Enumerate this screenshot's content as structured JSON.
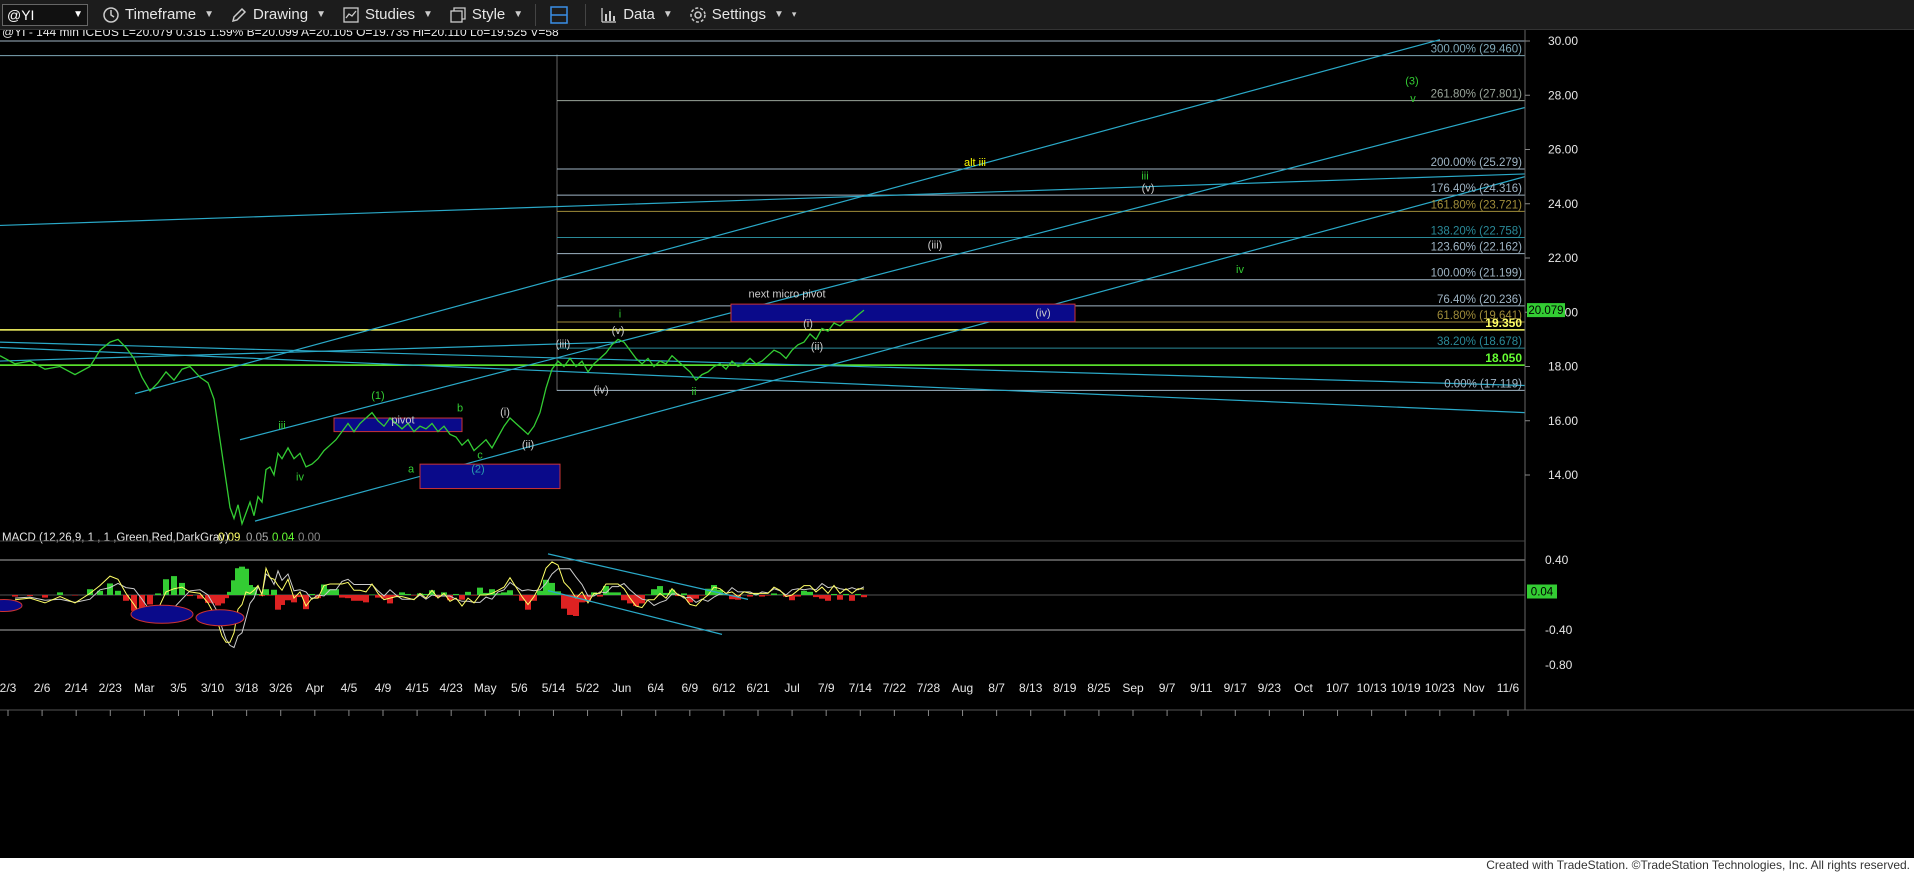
{
  "toolbar": {
    "symbol": "@YI",
    "items": [
      {
        "name": "timeframe",
        "label": "Timeframe",
        "icon": "clock-icon"
      },
      {
        "name": "drawing",
        "label": "Drawing",
        "icon": "pen-icon"
      },
      {
        "name": "studies",
        "label": "Studies",
        "icon": "studies-icon"
      },
      {
        "name": "style",
        "label": "Style",
        "icon": "style-icon"
      },
      {
        "name": "data",
        "label": "Data",
        "icon": "data-icon"
      },
      {
        "name": "settings",
        "label": "Settings",
        "icon": "gear-icon"
      }
    ]
  },
  "quote_header": {
    "line": "@YI - 144 min  ICEUS  L=20.079  0.315  1.59%  B=20.099  A=20.105  O=19.735  Hi=20.110  Lo=19.525  V=58"
  },
  "chart_data": {
    "type": "line",
    "symbol": "@YI",
    "interval": "144 min",
    "ylim": [
      12,
      30.2
    ],
    "price_ticks": [
      14,
      16,
      18,
      20,
      22,
      24,
      26,
      28,
      30
    ],
    "last_price": "20.079",
    "x_labels": [
      "2/3",
      "2/6",
      "2/14",
      "2/23",
      "Mar",
      "3/5",
      "3/10",
      "3/18",
      "3/26",
      "Apr",
      "4/5",
      "4/9",
      "4/15",
      "4/23",
      "May",
      "5/6",
      "5/14",
      "5/22",
      "Jun",
      "6/4",
      "6/9",
      "6/12",
      "6/21",
      "Jul",
      "7/9",
      "7/14",
      "7/22",
      "7/28",
      "Aug",
      "8/7",
      "8/13",
      "8/19",
      "8/25",
      "Sep",
      "9/7",
      "9/11",
      "9/17",
      "9/23",
      "Oct",
      "10/7",
      "10/13",
      "10/19",
      "10/23",
      "Nov",
      "11/6"
    ],
    "price_path": [
      [
        0,
        18.4
      ],
      [
        15,
        18.1
      ],
      [
        30,
        18.2
      ],
      [
        45,
        17.9
      ],
      [
        60,
        18.0
      ],
      [
        75,
        17.7
      ],
      [
        90,
        18.0
      ],
      [
        100,
        18.6
      ],
      [
        110,
        18.9
      ],
      [
        118,
        19.0
      ],
      [
        126,
        18.7
      ],
      [
        134,
        18.3
      ],
      [
        142,
        17.6
      ],
      [
        150,
        17.1
      ],
      [
        158,
        17.4
      ],
      [
        166,
        17.8
      ],
      [
        174,
        17.5
      ],
      [
        182,
        17.9
      ],
      [
        190,
        18.0
      ],
      [
        200,
        17.6
      ],
      [
        208,
        17.4
      ],
      [
        214,
        16.8
      ],
      [
        218,
        15.8
      ],
      [
        222,
        14.8
      ],
      [
        226,
        13.8
      ],
      [
        230,
        12.8
      ],
      [
        234,
        12.4
      ],
      [
        238,
        12.9
      ],
      [
        242,
        12.2
      ],
      [
        246,
        12.6
      ],
      [
        250,
        13.0
      ],
      [
        254,
        12.5
      ],
      [
        258,
        13.2
      ],
      [
        262,
        13.0
      ],
      [
        266,
        14.2
      ],
      [
        270,
        14.3
      ],
      [
        274,
        14.0
      ],
      [
        278,
        14.8
      ],
      [
        282,
        14.6
      ],
      [
        288,
        15.0
      ],
      [
        294,
        14.6
      ],
      [
        300,
        14.8
      ],
      [
        306,
        14.3
      ],
      [
        312,
        14.4
      ],
      [
        318,
        14.6
      ],
      [
        324,
        14.9
      ],
      [
        330,
        15.1
      ],
      [
        336,
        15.3
      ],
      [
        342,
        15.6
      ],
      [
        348,
        15.9
      ],
      [
        354,
        15.6
      ],
      [
        360,
        15.9
      ],
      [
        366,
        16.1
      ],
      [
        372,
        16.3
      ],
      [
        378,
        16.0
      ],
      [
        384,
        15.8
      ],
      [
        390,
        16.1
      ],
      [
        396,
        15.9
      ],
      [
        402,
        15.7
      ],
      [
        408,
        15.9
      ],
      [
        414,
        15.6
      ],
      [
        420,
        15.8
      ],
      [
        426,
        15.7
      ],
      [
        432,
        15.9
      ],
      [
        438,
        15.6
      ],
      [
        444,
        15.8
      ],
      [
        450,
        15.5
      ],
      [
        456,
        15.4
      ],
      [
        462,
        15.1
      ],
      [
        468,
        15.3
      ],
      [
        474,
        14.9
      ],
      [
        480,
        15.1
      ],
      [
        486,
        15.3
      ],
      [
        492,
        15.0
      ],
      [
        498,
        15.4
      ],
      [
        504,
        15.8
      ],
      [
        510,
        16.1
      ],
      [
        516,
        15.9
      ],
      [
        522,
        15.7
      ],
      [
        528,
        15.5
      ],
      [
        534,
        15.8
      ],
      [
        540,
        16.3
      ],
      [
        546,
        17.2
      ],
      [
        552,
        17.9
      ],
      [
        558,
        18.2
      ],
      [
        564,
        18.0
      ],
      [
        570,
        18.3
      ],
      [
        576,
        18.0
      ],
      [
        582,
        18.2
      ],
      [
        588,
        17.8
      ],
      [
        594,
        18.1
      ],
      [
        600,
        18.3
      ],
      [
        606,
        18.5
      ],
      [
        612,
        18.8
      ],
      [
        618,
        19.0
      ],
      [
        624,
        18.9
      ],
      [
        630,
        18.6
      ],
      [
        636,
        18.3
      ],
      [
        642,
        18.1
      ],
      [
        648,
        18.3
      ],
      [
        654,
        18.0
      ],
      [
        660,
        18.2
      ],
      [
        666,
        18.1
      ],
      [
        672,
        18.4
      ],
      [
        678,
        18.2
      ],
      [
        684,
        18.0
      ],
      [
        690,
        17.8
      ],
      [
        696,
        17.5
      ],
      [
        702,
        17.7
      ],
      [
        708,
        17.8
      ],
      [
        714,
        18.0
      ],
      [
        720,
        18.1
      ],
      [
        726,
        17.9
      ],
      [
        732,
        18.2
      ],
      [
        738,
        18.0
      ],
      [
        744,
        18.1
      ],
      [
        750,
        18.3
      ],
      [
        756,
        18.1
      ],
      [
        762,
        18.2
      ],
      [
        768,
        18.4
      ],
      [
        774,
        18.6
      ],
      [
        780,
        18.5
      ],
      [
        786,
        18.3
      ],
      [
        792,
        18.6
      ],
      [
        798,
        18.8
      ],
      [
        804,
        18.9
      ],
      [
        810,
        19.2
      ],
      [
        816,
        19.0
      ],
      [
        822,
        19.4
      ],
      [
        828,
        19.3
      ],
      [
        834,
        19.6
      ],
      [
        840,
        19.5
      ],
      [
        846,
        19.7
      ],
      [
        852,
        19.7
      ],
      [
        858,
        19.9
      ],
      [
        864,
        20.08
      ]
    ],
    "fib_levels": [
      {
        "pct": "300.00%",
        "val": "(29.460)",
        "price": 29.46,
        "color": "#7fa8b8"
      },
      {
        "pct": "261.80%",
        "val": "(27.801)",
        "price": 27.801,
        "color": "#9aa59a"
      },
      {
        "pct": "200.00%",
        "val": "(25.279)",
        "price": 25.279,
        "color": "#9fb5c5"
      },
      {
        "pct": "176.40%",
        "val": "(24.316)",
        "price": 24.316,
        "color": "#9fb5c5"
      },
      {
        "pct": "161.80%",
        "val": "(23.721)",
        "price": 23.721,
        "color": "#a08d3a"
      },
      {
        "pct": "138.20%",
        "val": "(22.758)",
        "price": 22.758,
        "color": "#2a8a99"
      },
      {
        "pct": "123.60%",
        "val": "(22.162)",
        "price": 22.162,
        "color": "#9fb5c5"
      },
      {
        "pct": "100.00%",
        "val": "(21.199)",
        "price": 21.199,
        "color": "#9fb5c5"
      },
      {
        "pct": "76.40%",
        "val": "(20.236)",
        "price": 20.236,
        "color": "#9fb5c5"
      },
      {
        "pct": "61.80%",
        "val": "(19.641)",
        "price": 19.641,
        "color": "#a08d3a"
      },
      {
        "pct": "38.20%",
        "val": "(18.678)",
        "price": 18.678,
        "color": "#2a8a99"
      },
      {
        "pct": "0.00%",
        "val": "(17.119)",
        "price": 17.119,
        "color": "#9fb5c5"
      }
    ],
    "horizontal_levels": [
      {
        "label": "19.350",
        "price": 19.35,
        "color": "#ffff66"
      },
      {
        "label": "18.050",
        "price": 18.05,
        "color": "#66ff33"
      }
    ],
    "wave_labels": [
      {
        "text": "(3)",
        "price": 28.4,
        "x": 1412,
        "color": "#33cc33"
      },
      {
        "text": "v",
        "price": 27.75,
        "x": 1413,
        "color": "#33cc33"
      },
      {
        "text": "alt iii",
        "price": 25.4,
        "x": 975,
        "color": "#ffff00"
      },
      {
        "text": "iii",
        "price": 24.9,
        "x": 1145,
        "color": "#33cc33"
      },
      {
        "text": "(v)",
        "price": 24.45,
        "x": 1148,
        "color": "#cccccc"
      },
      {
        "text": "(iii)",
        "price": 22.35,
        "x": 935,
        "color": "#cccccc"
      },
      {
        "text": "iv",
        "price": 21.45,
        "x": 1240,
        "color": "#33cc33"
      },
      {
        "text": "next micro pivot",
        "price": 20.55,
        "x": 787,
        "color": "#cccccc"
      },
      {
        "text": "(iv)",
        "price": 19.85,
        "x": 1043,
        "color": "#cccccc"
      },
      {
        "text": "(i)",
        "price": 19.45,
        "x": 808,
        "color": "#cccccc"
      },
      {
        "text": "(ii)",
        "price": 18.6,
        "x": 817,
        "color": "#cccccc"
      },
      {
        "text": "(iii)",
        "price": 18.7,
        "x": 563,
        "color": "#cccccc"
      },
      {
        "text": "(v)",
        "price": 19.2,
        "x": 618,
        "color": "#cccccc"
      },
      {
        "text": "i",
        "price": 19.8,
        "x": 620,
        "color": "#33cc33"
      },
      {
        "text": "(iv)",
        "price": 17.0,
        "x": 601,
        "color": "#cccccc"
      },
      {
        "text": "ii",
        "price": 16.95,
        "x": 694,
        "color": "#33cc33"
      },
      {
        "text": "(1)",
        "price": 16.8,
        "x": 378,
        "color": "#33cc33"
      },
      {
        "text": "pivot",
        "price": 15.9,
        "x": 403,
        "color": "#cccccc"
      },
      {
        "text": "b",
        "price": 16.35,
        "x": 460,
        "color": "#33cc33"
      },
      {
        "text": "(i)",
        "price": 16.2,
        "x": 505,
        "color": "#cccccc"
      },
      {
        "text": "iii",
        "price": 15.7,
        "x": 282,
        "color": "#33cc33"
      },
      {
        "text": "(ii)",
        "price": 15.0,
        "x": 528,
        "color": "#cccccc"
      },
      {
        "text": "c",
        "price": 14.6,
        "x": 480,
        "color": "#33cc33"
      },
      {
        "text": "(2)",
        "price": 14.1,
        "x": 478,
        "color": "#2a9db0"
      },
      {
        "text": "iv",
        "price": 13.8,
        "x": 300,
        "color": "#33cc33"
      },
      {
        "text": "a",
        "price": 14.1,
        "x": 411,
        "color": "#33cc33"
      }
    ],
    "macd": {
      "label": "MACD (12,26,9, 1 , 1 ,Green,Red,DarkGray)",
      "values": [
        "0.09",
        "0.05",
        "0.04",
        "0.00"
      ],
      "value_colors": [
        "#ffff66",
        "#aaaaaa",
        "#66ff33",
        "#888888"
      ],
      "ticks": [
        "0.40",
        "-0.40",
        "-0.80"
      ],
      "last_value": "0.04"
    }
  },
  "footer": {
    "credit": "Created with TradeStation. ©TradeStation Technologies, Inc. All rights reserved."
  }
}
